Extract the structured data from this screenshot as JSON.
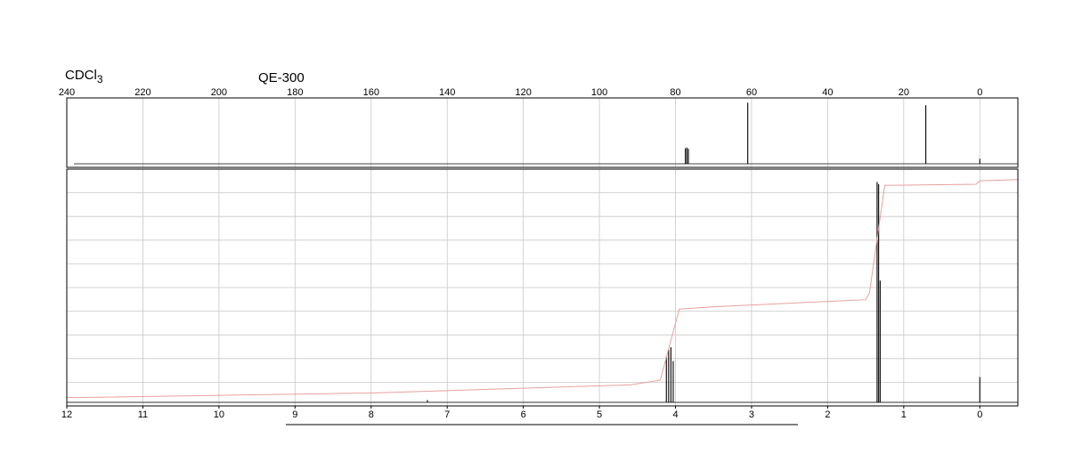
{
  "header": {
    "solvent_main": "CDCl",
    "solvent_sub": "3",
    "instrument": "QE-300"
  },
  "chart_data": [
    {
      "type": "line",
      "name": "13C NMR",
      "xlim": [
        240,
        -10
      ],
      "ticks": [
        240,
        220,
        200,
        180,
        160,
        140,
        120,
        100,
        80,
        60,
        40,
        20,
        0
      ],
      "tick_labels": [
        "240",
        "220",
        "200",
        "180",
        "160",
        "140",
        "120",
        "100",
        "80",
        "60",
        "40",
        "20",
        "0"
      ],
      "peaks": [
        {
          "x": 77.4,
          "height": 0.25
        },
        {
          "x": 77.0,
          "height": 0.26
        },
        {
          "x": 76.6,
          "height": 0.24
        },
        {
          "x": 61.0,
          "height": 0.98
        },
        {
          "x": 14.2,
          "height": 0.94
        },
        {
          "x": 0.0,
          "height": 0.08
        }
      ]
    },
    {
      "type": "line",
      "name": "1H NMR",
      "xlim": [
        12,
        -0.5
      ],
      "ticks": [
        12,
        11,
        10,
        9,
        8,
        7,
        6,
        5,
        4,
        3,
        2,
        1,
        0
      ],
      "tick_labels": [
        "12",
        "11",
        "10",
        "9",
        "8",
        "7",
        "6",
        "5",
        "4",
        "3",
        "2",
        "1",
        "0"
      ],
      "grid_rows": 10,
      "peaks": [
        {
          "x": 4.12,
          "height": 0.2
        },
        {
          "x": 4.09,
          "height": 0.23
        },
        {
          "x": 4.06,
          "height": 0.24
        },
        {
          "x": 4.03,
          "height": 0.18
        },
        {
          "x": 1.35,
          "height": 0.96
        },
        {
          "x": 1.33,
          "height": 0.95
        },
        {
          "x": 1.31,
          "height": 0.53
        },
        {
          "x": 7.26,
          "height": 0.01
        },
        {
          "x": 0.0,
          "height": 0.11
        }
      ],
      "integral": [
        {
          "x": 12.0,
          "y": 0.02
        },
        {
          "x": 8.0,
          "y": 0.04
        },
        {
          "x": 4.6,
          "y": 0.075
        },
        {
          "x": 4.2,
          "y": 0.095
        },
        {
          "x": 3.95,
          "y": 0.4
        },
        {
          "x": 3.5,
          "y": 0.41
        },
        {
          "x": 1.5,
          "y": 0.44
        },
        {
          "x": 1.45,
          "y": 0.47
        },
        {
          "x": 1.25,
          "y": 0.93
        },
        {
          "x": 0.05,
          "y": 0.935
        },
        {
          "x": 0.0,
          "y": 0.95
        },
        {
          "x": -0.5,
          "y": 0.955
        }
      ],
      "integral_color": "#e8a0a0"
    }
  ]
}
